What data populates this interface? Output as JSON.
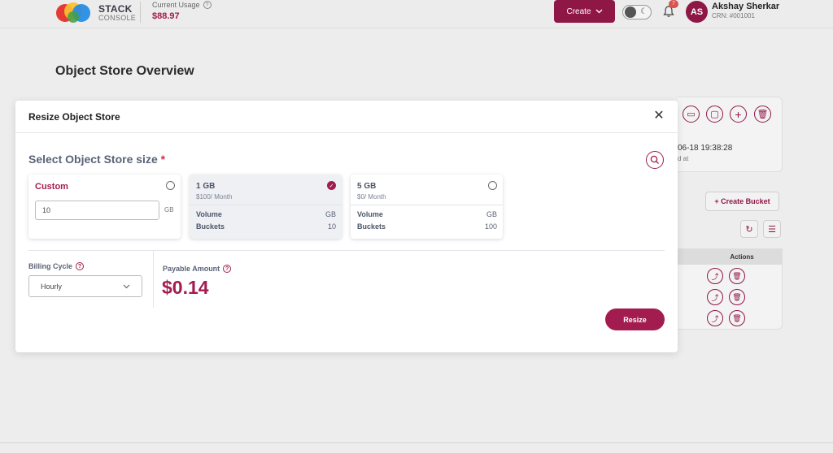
{
  "header": {
    "brand_line1": "STACK",
    "brand_line2": "CONSOLE",
    "usage_label": "Current Usage",
    "usage_amount": "$88.97",
    "create_label": "Create",
    "notification_count": "7",
    "user_initials": "AS",
    "user_name": "Akshay Sherkar",
    "user_crn": "CRN: #001001",
    "accent_color": "#8e1746"
  },
  "background": {
    "page_title": "Object Store Overview",
    "date_fragment": "06-18 19:38:28",
    "date_label_fragment": "d at",
    "create_bucket_label": "+ Create Bucket",
    "actions_header": "Actions"
  },
  "modal": {
    "title": "Resize Object Store",
    "section_title": "Select Object Store size",
    "required_mark": "*",
    "plans": [
      {
        "name": "Custom",
        "input_value": "10",
        "unit": "GB",
        "selected": false
      },
      {
        "name": "1 GB",
        "price": "$100/ Month",
        "volume_label": "Volume",
        "volume_value": "GB",
        "buckets_label": "Buckets",
        "buckets_value": "10",
        "selected": true
      },
      {
        "name": "5 GB",
        "price": "$0/ Month",
        "volume_label": "Volume",
        "volume_value": "GB",
        "buckets_label": "Buckets",
        "buckets_value": "100",
        "selected": false
      }
    ],
    "billing_cycle_label": "Billing Cycle",
    "billing_cycle_value": "Hourly",
    "payable_label": "Payable Amount",
    "payable_amount": "$0.14",
    "resize_label": "Resize",
    "accent_color": "#a31c4f"
  }
}
